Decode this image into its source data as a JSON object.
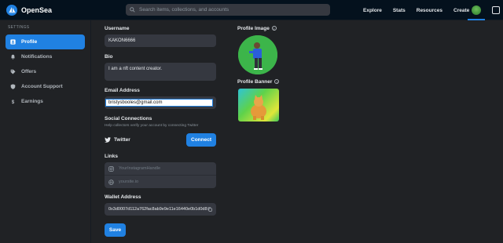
{
  "nav": {
    "brand": "OpenSea",
    "search_placeholder": "Search items, collections, and accounts",
    "links": [
      "Explore",
      "Stats",
      "Resources",
      "Create"
    ]
  },
  "sidebar": {
    "heading": "SETTINGS",
    "items": [
      {
        "label": "Profile",
        "icon": "profile-icon",
        "active": true
      },
      {
        "label": "Notifications",
        "icon": "bell-icon"
      },
      {
        "label": "Offers",
        "icon": "tag-icon"
      },
      {
        "label": "Account Support",
        "icon": "shield-icon"
      },
      {
        "label": "Earnings",
        "icon": "dollar-icon"
      }
    ]
  },
  "form": {
    "username_label": "Username",
    "username_value": "KAKON6666",
    "bio_label": "Bio",
    "bio_value": "I am a nft content creator.",
    "email_label": "Email Address",
    "email_value": "bristysbooles@gmail.com",
    "social_label": "Social Connections",
    "social_help": "Help collectors verify your account by connecting Twitter",
    "twitter_label": "Twitter",
    "connect_label": "Connect",
    "links_label": "Links",
    "instagram_placeholder": "YourInstagramHandle",
    "site_placeholder": "yoursite.io",
    "wallet_label": "Wallet Address",
    "wallet_value": "0x3d0007d112a762fac8ab9e9e11e16440e0b1d0d8",
    "save_label": "Save"
  },
  "right": {
    "profile_image_label": "Profile Image",
    "profile_banner_label": "Profile Banner"
  },
  "colors": {
    "accent": "#2081e2",
    "background": "#202225",
    "input": "#353840"
  }
}
